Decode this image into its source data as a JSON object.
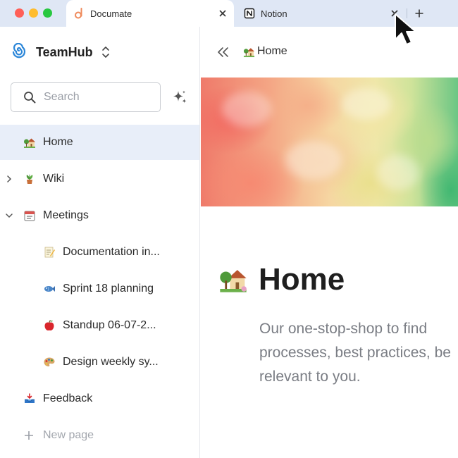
{
  "window": {
    "controls": [
      "close",
      "minimize",
      "maximize"
    ]
  },
  "tabs": [
    {
      "title": "Documate",
      "icon": "documate-logo-icon",
      "active": true
    },
    {
      "title": "Notion",
      "icon": "notion-logo-icon",
      "active": false
    }
  ],
  "sidebar": {
    "workspace_name": "TeamHub",
    "search_placeholder": "Search",
    "items": [
      {
        "label": "Home",
        "icon": "house-with-garden-icon",
        "level": 0,
        "active": true
      },
      {
        "label": "Wiki",
        "icon": "potted-plant-icon",
        "level": 0,
        "expandable": true,
        "expanded": false
      },
      {
        "label": "Meetings",
        "icon": "calendar-icon",
        "level": 0,
        "expandable": true,
        "expanded": true
      },
      {
        "label": "Documentation in...",
        "icon": "memo-icon",
        "level": 1
      },
      {
        "label": "Sprint 18 planning",
        "icon": "fish-icon",
        "level": 1
      },
      {
        "label": "Standup 06-07-2...",
        "icon": "apple-icon",
        "level": 1
      },
      {
        "label": "Design weekly sy...",
        "icon": "palette-icon",
        "level": 1
      },
      {
        "label": "Feedback",
        "icon": "inbox-tray-icon",
        "level": 0
      },
      {
        "label": "New page",
        "icon": "plus-icon",
        "level": 0,
        "muted": true
      }
    ]
  },
  "main": {
    "breadcrumb": "Home",
    "page_title": "Home",
    "page_description": "Our one-stop-shop to find processes, best practices, be relevant to you."
  },
  "colors": {
    "tabbar_bg": "#dfe7f5",
    "active_item_bg": "#e8eef9",
    "documate_orange": "#ef8a5b"
  }
}
